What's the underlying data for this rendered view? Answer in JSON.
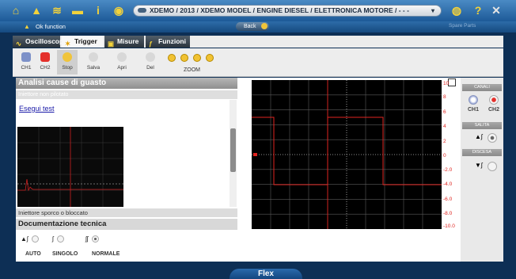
{
  "app": {
    "breadcrumb": "XDEMO / 2013 / XDEMO MODEL / ENGINE DIESEL / ELETTRONICA MOTORE / - - -",
    "ok_function": "Ok function",
    "back_label": "Back",
    "spare_parts": "Spare Parts",
    "bottom_tab": "Flex"
  },
  "tabs": [
    {
      "label": "Oscilloscopio",
      "active": false
    },
    {
      "label": "Trigger",
      "active": true
    },
    {
      "label": "Misure",
      "active": false
    },
    {
      "label": "Funzioni",
      "active": false
    }
  ],
  "toolbar": {
    "ch1": "CH1",
    "ch2": "CH2",
    "stop": "Stop",
    "salva": "Salva",
    "apri": "Apri",
    "del": "Del",
    "zoom": "ZOOM"
  },
  "left": {
    "section_title": "Analisi cause di guasto",
    "subsection": "Iniettore non pilotato",
    "link": "Esegui test",
    "injector_item": "Iniettore sporco o bloccato",
    "doc_title": "Documentazione tecnica",
    "trigger_modes": [
      "AUTO",
      "SINGOLO",
      "NORMALE"
    ]
  },
  "scope": {
    "y_labels": [
      "10",
      "8",
      "6",
      "4",
      "2",
      "0",
      "-2.0",
      "-4.0",
      "-6.0",
      "-8.0",
      "-10.0"
    ]
  },
  "side": {
    "canali": "CANALI",
    "ch1": "CH1",
    "ch2": "CH2",
    "salita": "SALITA",
    "discesa": "DISCESA"
  }
}
